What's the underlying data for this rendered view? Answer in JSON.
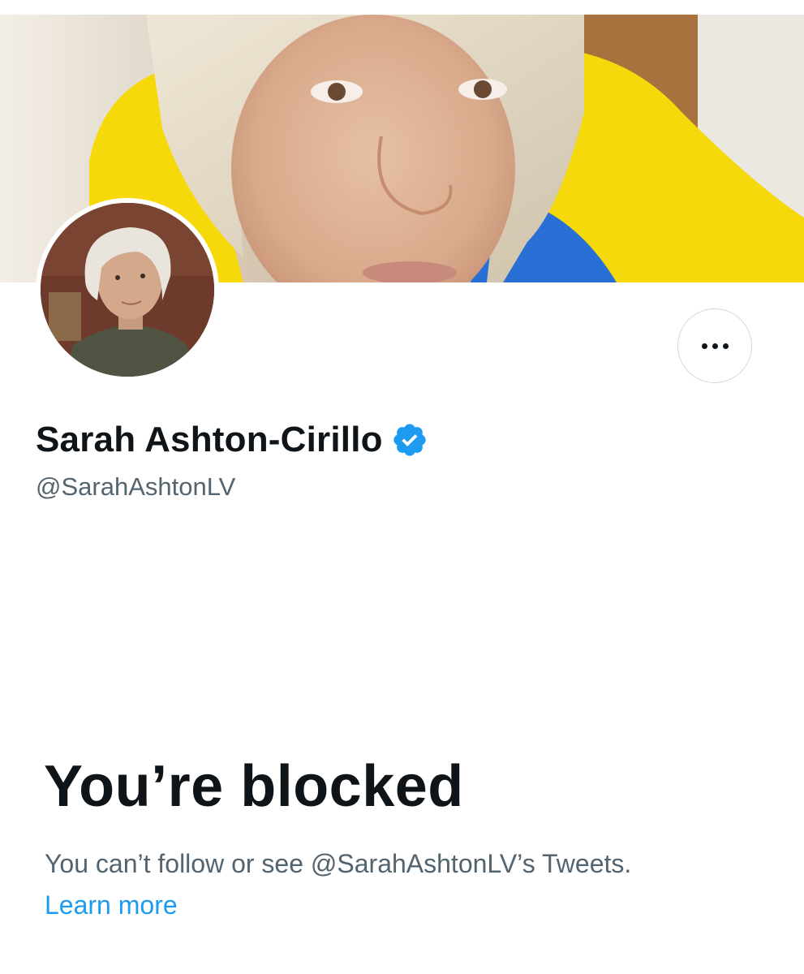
{
  "profile": {
    "display_name": "Sarah Ashton-Cirillo",
    "handle": "@SarahAshtonLV",
    "verified": true,
    "verified_color": "#1d9bf0"
  },
  "actions": {
    "more_icon": "more-horizontal-icon"
  },
  "blocked": {
    "title": "You’re blocked",
    "description": "You can’t follow or see @SarahAshtonLV’s Tweets.",
    "learn_more": "Learn more"
  },
  "colors": {
    "text_primary": "#0f1419",
    "text_secondary": "#536471",
    "link": "#1d9bf0",
    "border": "#cfd9de",
    "flag_yellow": "#f5d90a",
    "flag_blue": "#2a6fd6"
  }
}
